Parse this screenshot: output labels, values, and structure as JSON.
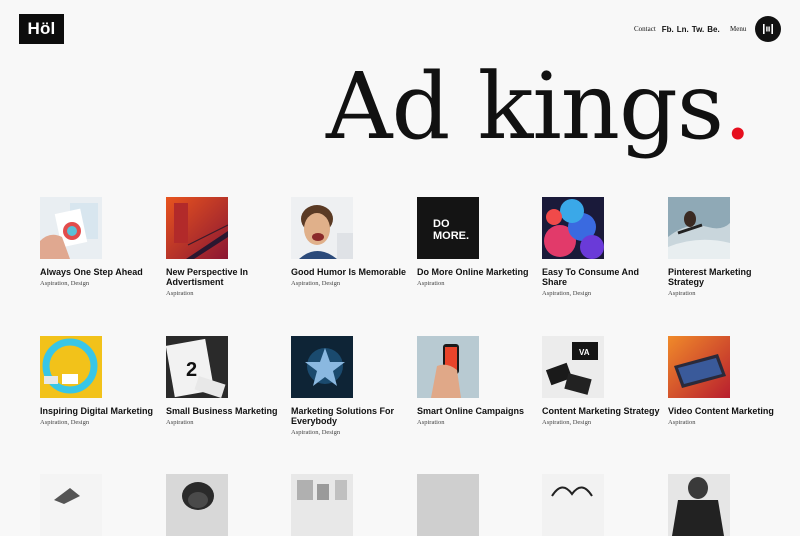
{
  "header": {
    "logo": "Höl",
    "contact": "Contact",
    "social": [
      "Fb.",
      "Ln.",
      "Tw.",
      "Be."
    ],
    "menu_label": "Menu"
  },
  "hero": {
    "title": "Ad kings",
    "dot": ".",
    "accent_color": "#e60f1e"
  },
  "posts": [
    {
      "title": "Always One Step Ahead",
      "tags": "Aspiration, Design",
      "image": "hand-holding-brochures"
    },
    {
      "title": "New Perspective In Advertisment",
      "tags": "Aspiration",
      "image": "red-architecture"
    },
    {
      "title": "Good Humor Is Memorable",
      "tags": "Aspiration, Design",
      "image": "laughing-boy"
    },
    {
      "title": "Do More Online Marketing",
      "tags": "Aspiration",
      "image": "do-more-sign"
    },
    {
      "title": "Easy To Consume And Share",
      "tags": "Aspiration, Design",
      "image": "colorful-smoke"
    },
    {
      "title": "Pinterest Marketing Strategy",
      "tags": "Aspiration",
      "image": "surfer-wave"
    },
    {
      "title": "Inspiring Digital Marketing",
      "tags": "Aspiration, Design",
      "image": "yellow-cyan-ring"
    },
    {
      "title": "Small Business Marketing",
      "tags": "Aspiration",
      "image": "magazine-numbers"
    },
    {
      "title": "Marketing Solutions For Everybody",
      "tags": "Aspiration, Design",
      "image": "blue-star-figure"
    },
    {
      "title": "Smart Online Campaigns",
      "tags": "Aspiration",
      "image": "hand-holding-phone"
    },
    {
      "title": "Content Marketing Strategy",
      "tags": "Aspiration, Design",
      "image": "branding-stationery"
    },
    {
      "title": "Video Content Marketing",
      "tags": "Aspiration",
      "image": "laptop-sunset"
    },
    {
      "title": "",
      "tags": "",
      "image": "white-object"
    },
    {
      "title": "",
      "tags": "",
      "image": "smiling-person"
    },
    {
      "title": "",
      "tags": "",
      "image": "portrait-frames"
    },
    {
      "title": "",
      "tags": "",
      "image": "grey-abstract"
    },
    {
      "title": "",
      "tags": "",
      "image": "lettering-art"
    },
    {
      "title": "",
      "tags": "",
      "image": "man-in-suit"
    }
  ]
}
